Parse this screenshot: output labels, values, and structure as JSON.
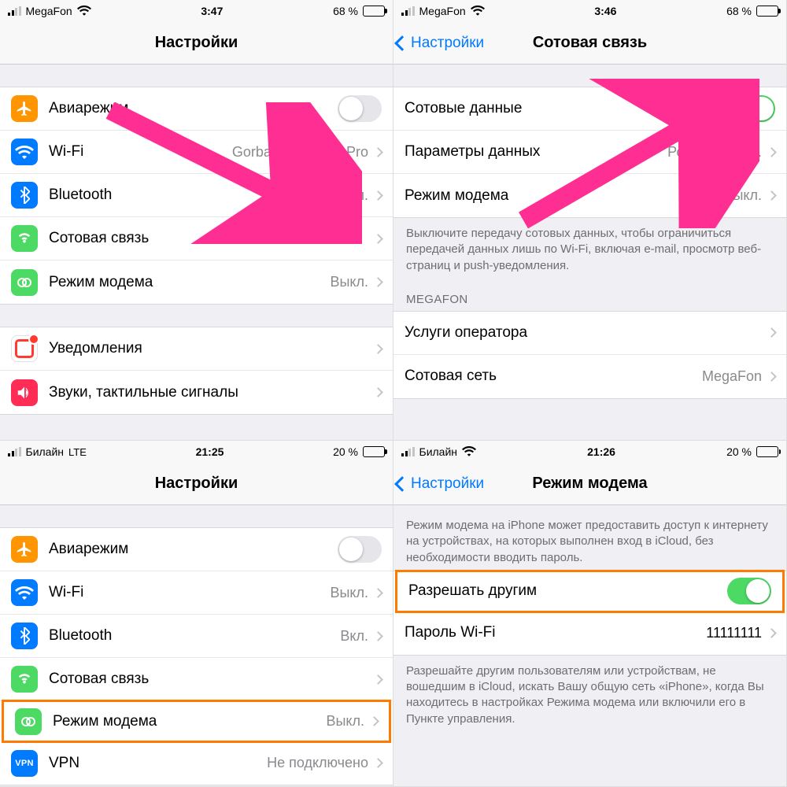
{
  "screens": {
    "s1": {
      "status": {
        "carrier": "MegaFon",
        "net": "wifi",
        "time": "3:47",
        "battery_pct": "68 %",
        "battery_fill": 68
      },
      "title": "Настройки",
      "rows": [
        {
          "label": "Авиарежим",
          "toggle": false
        },
        {
          "label": "Wi-Fi",
          "value": "Gorban MacBook Pro"
        },
        {
          "label": "Bluetooth",
          "value": "Вкл."
        },
        {
          "label": "Сотовая связь",
          "value": ""
        },
        {
          "label": "Режим модема",
          "value": "Выкл."
        }
      ],
      "rows2": [
        {
          "label": "Уведомления"
        },
        {
          "label": "Звуки, тактильные сигналы"
        }
      ]
    },
    "s2": {
      "status": {
        "carrier": "MegaFon",
        "net": "wifi",
        "time": "3:46",
        "battery_pct": "68 %",
        "battery_fill": 68
      },
      "back": "Настройки",
      "title": "Сотовая связь",
      "rows": [
        {
          "label": "Сотовые данные",
          "toggle": true
        },
        {
          "label": "Параметры данных",
          "value": "Роуминг выкл."
        },
        {
          "label": "Режим модема",
          "value": "Выкл."
        }
      ],
      "footer": "Выключите передачу сотовых данных, чтобы ограничиться передачей данных лишь по Wi-Fi, включая e-mail, просмотр веб-страниц и push-уведомления.",
      "section": "MEGAFON",
      "rows2": [
        {
          "label": "Услуги оператора"
        },
        {
          "label": "Сотовая сеть",
          "value": "MegaFon"
        }
      ]
    },
    "s3": {
      "status": {
        "carrier": "Билайн",
        "net": "LTE",
        "time": "21:25",
        "battery_pct": "20 %",
        "battery_fill": 20
      },
      "title": "Настройки",
      "rows": [
        {
          "label": "Авиарежим",
          "toggle": false
        },
        {
          "label": "Wi-Fi",
          "value": "Выкл."
        },
        {
          "label": "Bluetooth",
          "value": "Вкл."
        },
        {
          "label": "Сотовая связь",
          "value": ""
        },
        {
          "label": "Режим модема",
          "value": "Выкл."
        },
        {
          "label": "VPN",
          "value": "Не подключено"
        }
      ]
    },
    "s4": {
      "status": {
        "carrier": "Билайн",
        "net": "wifi",
        "time": "21:26",
        "battery_pct": "20 %",
        "battery_fill": 20
      },
      "back": "Настройки",
      "title": "Режим модема",
      "intro": "Режим модема на iPhone может предоставить доступ к интернету на устройствах, на которых выполнен вход в iCloud, без необходимости вводить пароль.",
      "rows": [
        {
          "label": "Разрешать другим",
          "toggle": true
        },
        {
          "label": "Пароль Wi-Fi",
          "value": "11111111"
        }
      ],
      "footer": "Разрешайте другим пользователям или устройствам, не вошедшим в iCloud, искать Вашу общую сеть «iPhone», когда Вы находитесь в настройках Режима модема или включили его в Пункте управления."
    }
  }
}
